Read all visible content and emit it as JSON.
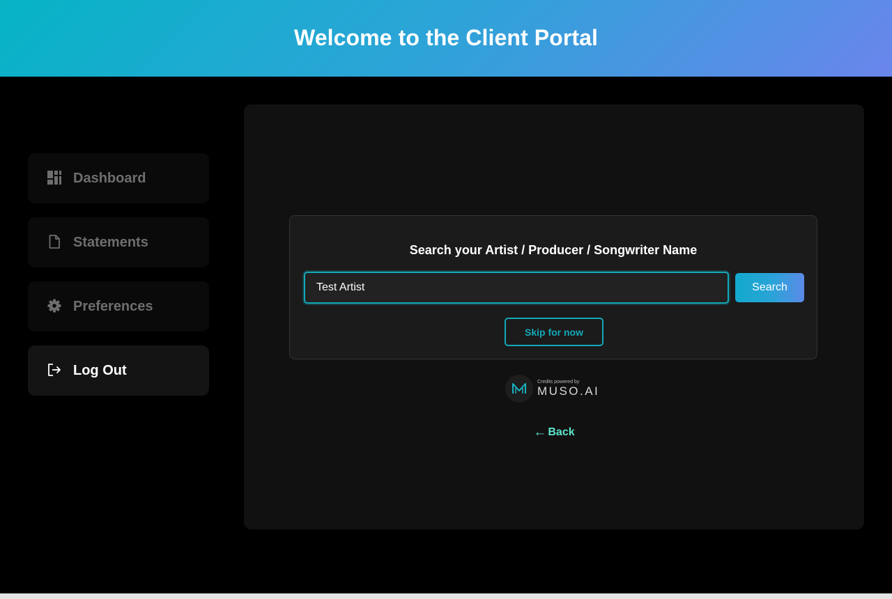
{
  "header": {
    "title": "Welcome to the Client Portal"
  },
  "sidebar": {
    "items": [
      {
        "label": "Dashboard",
        "icon": "dashboard-icon",
        "active": false
      },
      {
        "label": "Statements",
        "icon": "document-icon",
        "active": false
      },
      {
        "label": "Preferences",
        "icon": "gear-icon",
        "active": false
      },
      {
        "label": "Log Out",
        "icon": "logout-icon",
        "active": true
      }
    ]
  },
  "search": {
    "title": "Search your Artist / Producer / Songwriter Name",
    "input_value": "Test Artist",
    "search_label": "Search",
    "skip_label": "Skip for now"
  },
  "credits": {
    "caption": "Credits powered by",
    "brand": "MUSO.AI"
  },
  "back": {
    "arrow": "←",
    "label": "Back"
  },
  "colors": {
    "accent": "#13a8b8",
    "back_link": "#5ee6cc",
    "header_gradient_start": "#06b4c6",
    "header_gradient_end": "#6a85ec",
    "background": "#000000",
    "card": "#111111"
  }
}
